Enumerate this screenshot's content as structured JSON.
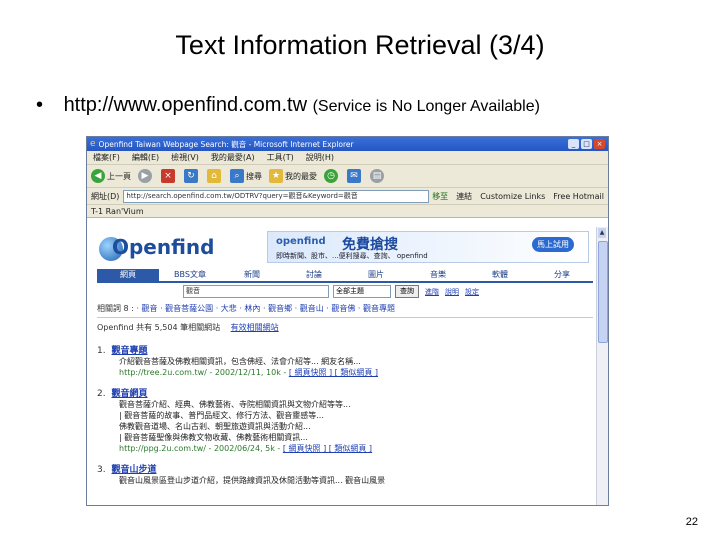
{
  "slide": {
    "title": "Text Information Retrieval (3/4)",
    "bullet": "•",
    "url": "http://www.openfind.com.tw",
    "note": "(Service is No Longer Available)",
    "page_number": "22"
  },
  "browser": {
    "window_title": "Openfind Taiwan Webpage Search: 觀音 - Microsoft Internet Explorer",
    "menu": [
      "檔案(F)",
      "編輯(E)",
      "檢視(V)",
      "我的最愛(A)",
      "工具(T)",
      "說明(H)"
    ],
    "toolbar": {
      "back": "上一頁",
      "search": "搜尋",
      "favorites": "我的最愛"
    },
    "address_label": "網址(D)",
    "address_value": "http://search.openfind.com.tw/ODTRV?query=觀音&Keyword=觀音",
    "go_label": "移至",
    "links": [
      "連結",
      "Customize Links",
      "Free Hotmail"
    ],
    "links_bar_label": "T-1  Ran'Vium"
  },
  "site": {
    "logo": "Openfind",
    "banner": {
      "brand": "openfind",
      "slogan": "免費搶搜",
      "sub": "即時新聞、股市、...便利搜尋、查詢、 openfind",
      "try_label": "馬上試用"
    },
    "tabs": [
      "網頁",
      "BBS文章",
      "新聞",
      "討論",
      "圖片",
      "音樂",
      "軟體",
      "分享"
    ],
    "search": {
      "query": "觀音",
      "select": "全部主題",
      "button": "查詢",
      "links": [
        "進階",
        "說明",
        "設定"
      ]
    },
    "related": {
      "prefix": "相關詞 8 : ",
      "items": [
        "· 觀音",
        "· 觀音菩薩公園",
        "· 大悲",
        "· 林內",
        "· 觀音鄉",
        "· 觀音山",
        "· 觀音佛",
        "· 觀音專題"
      ]
    },
    "count_text": "Openfind 共有 5,504 筆相關網站",
    "count_link": "有效相關網站"
  },
  "results": [
    {
      "num": "1.",
      "title": "觀音專題",
      "snippets": [
        "介紹觀音菩薩及佛教相關資訊，包含佛經、法會介紹等... 網友名稱..."
      ],
      "url": "http://tree.2u.com.tw/ - 2002/12/11, 10k -",
      "url_links": "[ 網頁快照 ] [ 類似網頁 ]"
    },
    {
      "num": "2.",
      "title": "觀音網頁",
      "snippets": [
        "觀音菩薩介紹、經典、佛教藝術、寺院相關資訊與文物介紹等等...",
        "| 觀音菩薩的故事、普門品經文、修行方法、觀音靈感等...",
        "佛教觀音道場、名山古剎、朝聖旅遊資訊與活動介紹...",
        "| 觀音菩薩聖像與佛教文物收藏、佛教藝術相關資訊..."
      ],
      "url": "http://ppg.2u.com.tw/ - 2002/06/24, 5k -",
      "url_links": "[ 網頁快照 ] [ 類似網頁 ]"
    },
    {
      "num": "3.",
      "title": "觀音山步道",
      "snippets": [
        "觀音山風景區登山步道介紹，提供路線資訊及休閒活動等資訊... 觀音山風景"
      ],
      "url": "",
      "url_links": ""
    }
  ]
}
